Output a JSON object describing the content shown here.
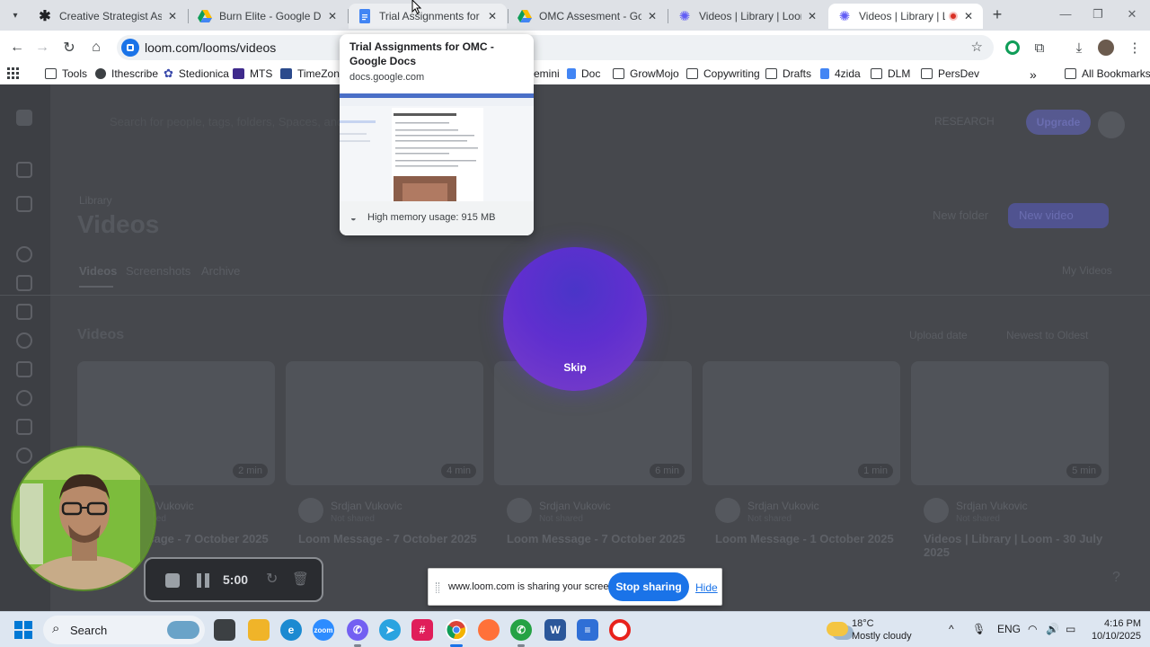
{
  "browser": {
    "tabs": [
      {
        "title": "Creative Strategist Assessm",
        "favicon": "asterisk-icon"
      },
      {
        "title": "Burn Elite - Google Drive",
        "favicon": "google-drive-icon"
      },
      {
        "title": "Trial Assignments for OMC",
        "favicon": "google-docs-icon"
      },
      {
        "title": "OMC Assesment - Google",
        "favicon": "google-drive-icon"
      },
      {
        "title": "Videos | Library | Loom",
        "favicon": "loom-icon"
      },
      {
        "title": "Videos | Library | Loom",
        "favicon": "loom-icon"
      }
    ],
    "url": "loom.com/looms/videos",
    "bookmarks": [
      "Tools",
      "Ithescribe",
      "Stedionica",
      "MTS",
      "TimeZones",
      "emini",
      "Doc",
      "GrowMojo",
      "Copywriting",
      "Drafts",
      "4zida",
      "DLM",
      "PersDev"
    ],
    "all_bookmarks": "All Bookmarks",
    "more": "»"
  },
  "hover_card": {
    "title": "Trial Assignments for OMC - Google Docs",
    "domain": "docs.google.com",
    "memory": "High memory usage: 915 MB"
  },
  "loom": {
    "header": {
      "search_hint": "Search for people, tags, folders, Spaces, and Looms",
      "badge": "RESEARCH",
      "upgrade": "Upgrade"
    },
    "breadcrumb": "Library",
    "title": "Videos",
    "new_folder": "New folder",
    "new_video": "New video",
    "tabs": [
      "Videos",
      "Screenshots",
      "Archive"
    ],
    "my_videos": "My Videos",
    "section": "Videos",
    "sort": [
      "Upload date",
      "Newest to Oldest"
    ],
    "videos": [
      {
        "duration": "2 min",
        "author": "Srdjan Vukovic",
        "sub": "Not shared",
        "title": "Loom Message - 7 October 2025"
      },
      {
        "duration": "4 min",
        "author": "Srdjan Vukovic",
        "sub": "Not shared",
        "title": "Loom Message - 7 October 2025"
      },
      {
        "duration": "6 min",
        "author": "Srdjan Vukovic",
        "sub": "Not shared",
        "title": "Loom Message - 7 October 2025"
      },
      {
        "duration": "1 min",
        "author": "Srdjan Vukovic",
        "sub": "Not shared",
        "title": "Loom Message - 1 October 2025"
      },
      {
        "duration": "5 min",
        "author": "Srdjan Vukovic",
        "sub": "Not shared",
        "title": "Videos | Library | Loom - 30 July 2025"
      }
    ],
    "countdown_skip": "Skip"
  },
  "recorder": {
    "time": "5:00"
  },
  "share_bar": {
    "message": "www.loom.com is sharing your screen.",
    "stop": "Stop sharing",
    "hide": "Hide"
  },
  "taskbar": {
    "search": "Search",
    "weather_temp": "18°C",
    "weather_desc": "Mostly cloudy",
    "lang": "ENG",
    "time": "4:16 PM",
    "date": "10/10/2025"
  }
}
